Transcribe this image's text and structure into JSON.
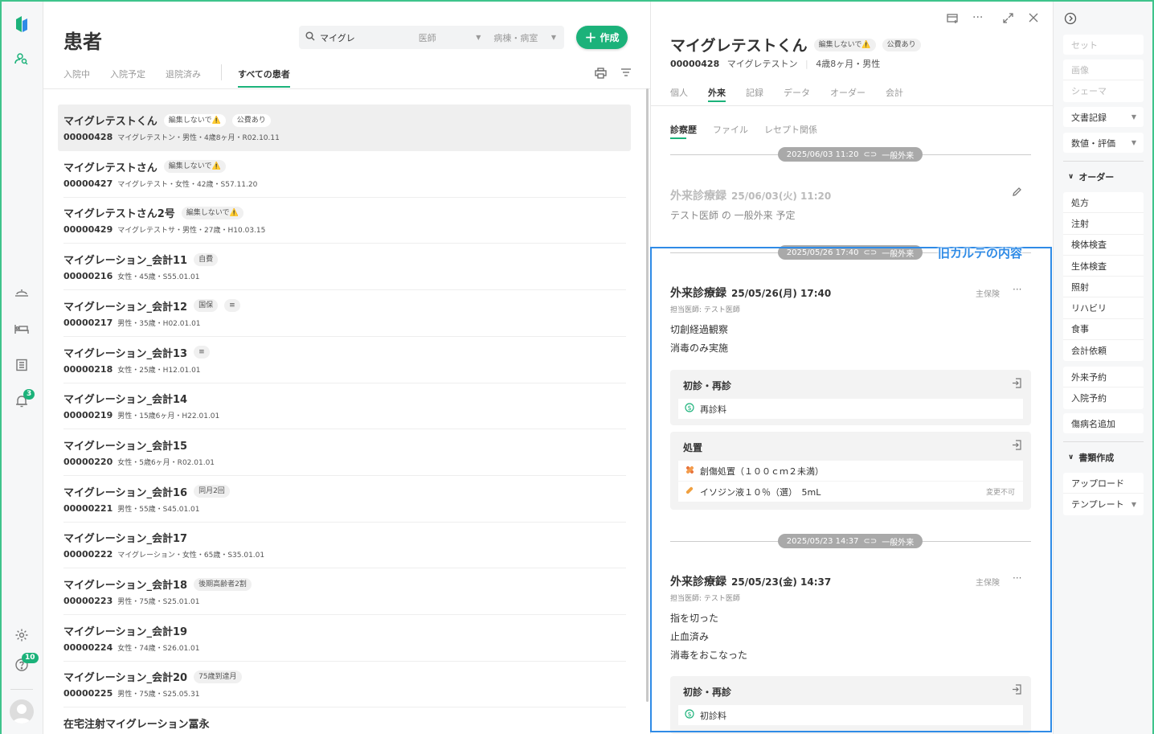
{
  "rail": {
    "notif_count": "3",
    "help_count": "10"
  },
  "list": {
    "title": "患者",
    "search": {
      "value": "マイグレ",
      "doctor_placeholder": "医師",
      "ward_placeholder": "病棟・病室"
    },
    "create_label": "作成",
    "tabs": [
      "入院中",
      "入院予定",
      "退院済み",
      "すべての患者"
    ],
    "patients": [
      {
        "name": "マイグレテストくん",
        "tags": [
          "編集しないで⚠️",
          "公費あり"
        ],
        "id": "00000428",
        "info": "マイグレテストン・男性・4歳8ヶ月・R02.10.11"
      },
      {
        "name": "マイグレテストさん",
        "tags": [
          "編集しないで⚠️"
        ],
        "id": "00000427",
        "info": "マイグレテスト・女性・42歳・S57.11.20"
      },
      {
        "name": "マイグレテストさん2号",
        "tags": [
          "編集しないで⚠️"
        ],
        "id": "00000429",
        "info": "マイグレテストサ・男性・27歳・H10.03.15"
      },
      {
        "name": "マイグレーション_会計11",
        "tags": [
          "自費"
        ],
        "id": "00000216",
        "info": "女性・45歳・S55.01.01"
      },
      {
        "name": "マイグレーション_会計12",
        "tags": [
          "国保",
          "≡"
        ],
        "id": "00000217",
        "info": "男性・35歳・H02.01.01"
      },
      {
        "name": "マイグレーション_会計13",
        "tags": [
          "≡"
        ],
        "id": "00000218",
        "info": "女性・25歳・H12.01.01"
      },
      {
        "name": "マイグレーション_会計14",
        "tags": [],
        "id": "00000219",
        "info": "男性・15歳6ヶ月・H22.01.01"
      },
      {
        "name": "マイグレーション_会計15",
        "tags": [],
        "id": "00000220",
        "info": "女性・5歳6ヶ月・R02.01.01"
      },
      {
        "name": "マイグレーション_会計16",
        "tags": [
          "同月2回"
        ],
        "id": "00000221",
        "info": "男性・55歳・S45.01.01"
      },
      {
        "name": "マイグレーション_会計17",
        "tags": [],
        "id": "00000222",
        "info": "マイグレーション・女性・65歳・S35.01.01"
      },
      {
        "name": "マイグレーション_会計18",
        "tags": [
          "後期高齢者2割"
        ],
        "id": "00000223",
        "info": "男性・75歳・S25.01.01"
      },
      {
        "name": "マイグレーション_会計19",
        "tags": [],
        "id": "00000224",
        "info": "女性・74歳・S26.01.01"
      },
      {
        "name": "マイグレーション_会計20",
        "tags": [
          "75歳到達月"
        ],
        "id": "00000225",
        "info": "男性・75歳・S25.05.31"
      },
      {
        "name": "在宅注射マイグレーション冨永",
        "tags": [],
        "id": "",
        "info": ""
      }
    ]
  },
  "detail": {
    "name": "マイグレテストくん",
    "tags": [
      "編集しないで⚠️",
      "公費あり"
    ],
    "id": "00000428",
    "kana": "マイグレテストン",
    "age_sex": "4歳8ヶ月・男性",
    "tabs": [
      "個人",
      "外来",
      "記録",
      "データ",
      "オーダー",
      "会計"
    ],
    "subtabs": [
      "診察歴",
      "ファイル",
      "レセプト関係"
    ],
    "sep1": {
      "datetime": "2025/06/03 11:20",
      "type": "一般外来"
    },
    "planned": {
      "title": "外来診療録",
      "date": "25/06/03(火) 11:20",
      "sub": "テスト医師 の 一般外来 予定"
    },
    "sep2": {
      "datetime": "2025/05/26 17:40",
      "type": "一般外来"
    },
    "rec1": {
      "title": "外来診療録",
      "date": "25/05/26(月) 17:40",
      "doctor": "担当医師: テスト医師",
      "insurance": "主保険",
      "lines": [
        "切創経過観察",
        "消毒のみ実施"
      ],
      "card1": {
        "heading": "初診・再診",
        "items": [
          {
            "label": "再診料"
          }
        ]
      },
      "card2": {
        "heading": "処置",
        "items": [
          {
            "label": "創傷処置（１００ｃｍ２未満）"
          },
          {
            "label": "イソジン液１０％（選）　5mL",
            "note": "変更不可"
          }
        ]
      }
    },
    "sep3": {
      "datetime": "2025/05/23 14:37",
      "type": "一般外来"
    },
    "rec2": {
      "title": "外来診療録",
      "date": "25/05/23(金) 14:37",
      "doctor": "担当医師: テスト医師",
      "insurance": "主保険",
      "lines": [
        "指を切った",
        "止血済み",
        "消毒をおこなった"
      ],
      "card1": {
        "heading": "初診・再診",
        "items": [
          {
            "label": "初診料"
          }
        ]
      }
    },
    "highlight_label": "旧カルテの内容"
  },
  "side": {
    "set": "セット",
    "image": "画像",
    "schema": "シェーマ",
    "doc_record": "文書記録",
    "values": "数値・評価",
    "order_header": "オーダー",
    "orders": [
      "処方",
      "注射",
      "検体検査",
      "生体検査",
      "照射",
      "リハビリ",
      "食事",
      "会計依頼"
    ],
    "reservations": [
      "外来予約",
      "入院予約"
    ],
    "disease_add": "傷病名追加",
    "docs_header": "書類作成",
    "upload": "アップロード",
    "template": "テンプレート"
  },
  "colors": {
    "accent": "#1bb27a",
    "highlight": "#2f8be6",
    "pill": "#a9a9a9"
  }
}
